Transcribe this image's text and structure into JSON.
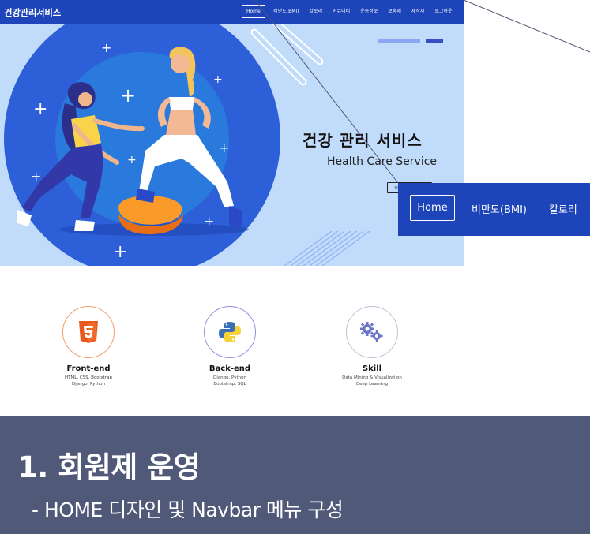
{
  "navbar": {
    "brand": "건강관리서비스",
    "items": [
      {
        "label": "Home",
        "active": true
      },
      {
        "label": "비만도(BMI)"
      },
      {
        "label": "칼로리"
      },
      {
        "label": "커뮤니티"
      },
      {
        "label": "운동정보"
      },
      {
        "label": "보충제"
      },
      {
        "label": "제작자"
      },
      {
        "label": "로그아웃"
      }
    ]
  },
  "hero": {
    "title": "건강 관리 서비스",
    "subtitle": "Health Care Service",
    "button_label": "커뮤니티 바로가기",
    "illustration": "two-women-exercising-illustration"
  },
  "zoom": {
    "home": "Home",
    "bmi": "비만도(BMI)",
    "calorie": "칼로리"
  },
  "features": [
    {
      "title": "Front-end",
      "desc1": "HTML, CSS, Bootstrap",
      "desc2": "Django, Python",
      "icon": "html5-icon",
      "ring": "#f0a070"
    },
    {
      "title": "Back-end",
      "desc1": "Django, Python",
      "desc2": "Bootstrap, SQL",
      "icon": "python-icon",
      "ring": "#9090e0"
    },
    {
      "title": "Skill",
      "desc1": "Data Mining & Visualization",
      "desc2": "Deep Learning",
      "icon": "gears-icon",
      "ring": "#c0c0d8"
    }
  ],
  "caption": {
    "heading": "1. 회원제 운영",
    "subheading": "- HOME 디자인 및 Navbar 메뉴 구성"
  },
  "colors": {
    "nav_blue": "#1d44b8",
    "hero_bg": "#c0dcfa",
    "caption_bg": "#515978"
  }
}
